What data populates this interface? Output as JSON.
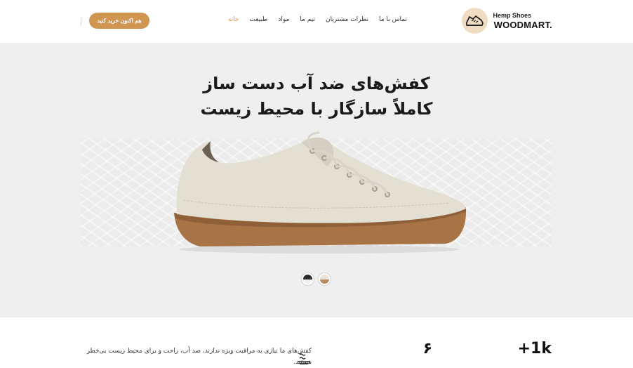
{
  "header": {
    "logo_top": "Hemp Shoes",
    "logo_main": "WOODMART.",
    "nav": [
      {
        "label": "خانه",
        "active": true
      },
      {
        "label": "طبیعت",
        "active": false
      },
      {
        "label": "مواد",
        "active": false
      },
      {
        "label": "تیم ما",
        "active": false
      },
      {
        "label": "نظرات مشتریان",
        "active": false
      },
      {
        "label": "تماس با ما",
        "active": false
      }
    ],
    "cta_label": "هم اکنون خرید کنید"
  },
  "hero": {
    "title_line1": "کفش‌های ضد آب دست ساز",
    "title_line2": "کاملاً سازگار با محیط زیست",
    "color_options": [
      {
        "name": "black",
        "top": "#2b2b2b",
        "bottom": "#f2f2f2"
      },
      {
        "name": "tan",
        "top": "#e9e4da",
        "bottom": "#b98a60"
      }
    ]
  },
  "features": {
    "stat1_value": "+1k",
    "stat2_value": "۶",
    "description": "کفش‌های ما نیازی به مراقبت ویژه ندارند، ضد آب، راحت و برای محیط زیست بی‌خطر هستند."
  },
  "colors": {
    "accent": "#d09551",
    "active_nav": "#d29a4c",
    "hero_bg": "#efefef"
  }
}
